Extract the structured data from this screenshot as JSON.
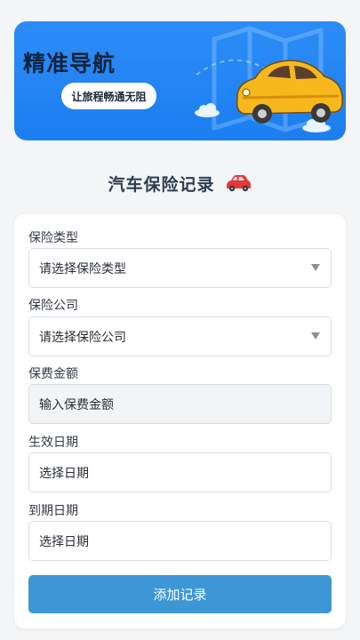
{
  "banner": {
    "title": "精准导航",
    "tagline": "让旅程畅通无阻",
    "illustration": "map-with-cartoon-car"
  },
  "page": {
    "title": "汽车保险记录",
    "title_icon": "red-car-icon"
  },
  "form": {
    "insurance_type": {
      "label": "保险类型",
      "placeholder": "请选择保险类型"
    },
    "insurance_company": {
      "label": "保险公司",
      "placeholder": "请选择保险公司"
    },
    "premium": {
      "label": "保费金额",
      "placeholder": "输入保费金额"
    },
    "effective_date": {
      "label": "生效日期",
      "placeholder": "选择日期"
    },
    "expiry_date": {
      "label": "到期日期",
      "placeholder": "选择日期"
    },
    "submit_label": "添加记录"
  },
  "colors": {
    "banner_blue": "#1b7ef0",
    "button_blue": "#3d97d6",
    "page_bg": "#f4f5f7",
    "car_yellow": "#f6b81c"
  }
}
